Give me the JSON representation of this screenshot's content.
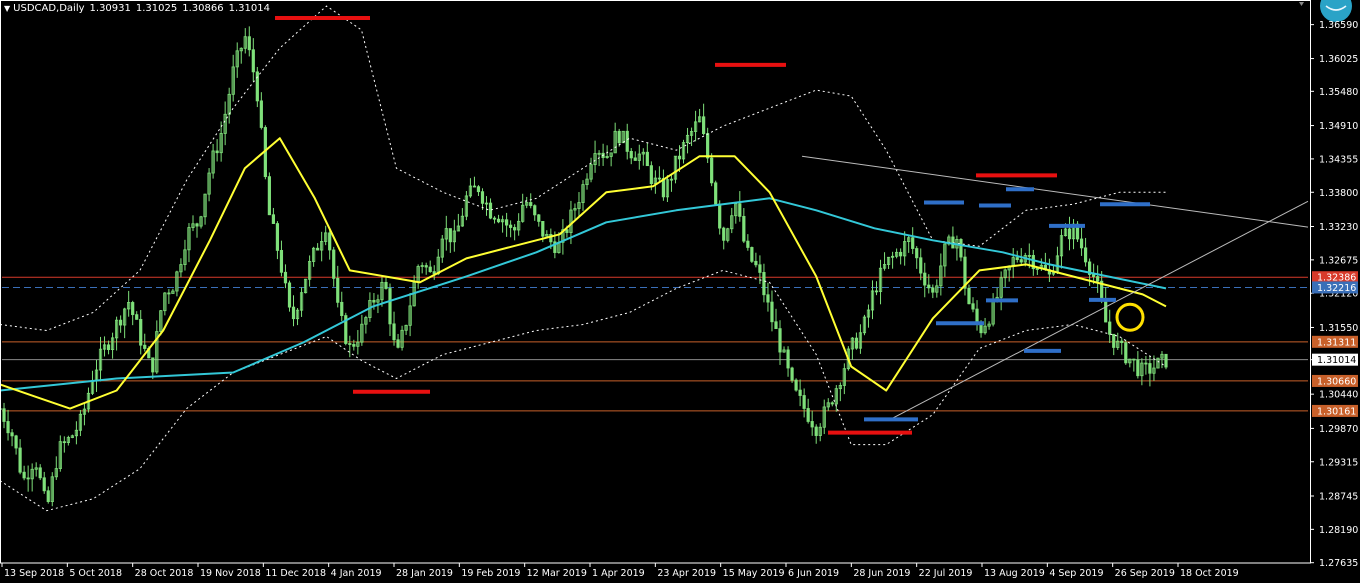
{
  "header": {
    "symbol": "USDCAD,Daily",
    "open": "1.30931",
    "high": "1.31025",
    "low": "1.30866",
    "close": "1.31014"
  },
  "colors": {
    "background": "#000000",
    "grid_frame": "#ffffff",
    "candle": "#7fe07a",
    "ma_fast": "#ffff33",
    "ma_slow": "#33c8d8",
    "bollinger": "#ffffff",
    "support_resistance": "#e04030",
    "marker_red": "#e81010",
    "marker_blue": "#2f6fc8",
    "circle": "#ffe000",
    "price_tag_orange": "#c8602a",
    "price_tag_red": "#d83a2a",
    "price_tag_blue": "#3a6fb8",
    "price_tag_current": "#ffffff"
  },
  "chart_data": {
    "type": "line",
    "ylim": [
      1.2763,
      1.368
    ],
    "y_ticks": [
      "1.36590",
      "1.36025",
      "1.35480",
      "1.34910",
      "1.34355",
      "1.33800",
      "1.33230",
      "1.32675",
      "1.32120",
      "1.31550",
      "1.31014",
      "1.30440",
      "1.29870",
      "1.29315",
      "1.28745",
      "1.28190",
      "1.27635"
    ],
    "x_tick_labels": [
      "13 Sep 2018",
      "5 Oct 2018",
      "28 Oct 2018",
      "19 Nov 2018",
      "11 Dec 2018",
      "4 Jan 2019",
      "28 Jan 2019",
      "19 Feb 2019",
      "12 Mar 2019",
      "1 Apr 2019",
      "23 Apr 2019",
      "15 May 2019",
      "6 Jun 2019",
      "28 Jun 2019",
      "22 Jul 2019",
      "13 Aug 2019",
      "4 Sep 2019",
      "26 Sep 2019",
      "18 Oct 2019"
    ],
    "series": [
      {
        "key": "price",
        "t": [
          0,
          0.01,
          0.02,
          0.03,
          0.04,
          0.05,
          0.06,
          0.07,
          0.08,
          0.09,
          0.1,
          0.11,
          0.12,
          0.13,
          0.14,
          0.15,
          0.16,
          0.17,
          0.18,
          0.19,
          0.2,
          0.21,
          0.22,
          0.23,
          0.24,
          0.25,
          0.26,
          0.27,
          0.28,
          0.29,
          0.3,
          0.31,
          0.32,
          0.33,
          0.34,
          0.35,
          0.36,
          0.37,
          0.38,
          0.39,
          0.4,
          0.41,
          0.42,
          0.43,
          0.44,
          0.45,
          0.46,
          0.47,
          0.48,
          0.49,
          0.5,
          0.51,
          0.52,
          0.53,
          0.54,
          0.55,
          0.56,
          0.57,
          0.58,
          0.59,
          0.6,
          0.61,
          0.62,
          0.63,
          0.64,
          0.65,
          0.66,
          0.67,
          0.68,
          0.69,
          0.7,
          0.71,
          0.72,
          0.73,
          0.74,
          0.75,
          0.76,
          0.77,
          0.78,
          0.79,
          0.8,
          0.81,
          0.82,
          0.83,
          0.84,
          0.85,
          0.86,
          0.87,
          0.88,
          0.89,
          0.9,
          0.91,
          0.92,
          0.93,
          0.94,
          0.95,
          0.96,
          0.97,
          0.98,
          0.99,
          1.0
        ],
        "y": [
          1.302,
          1.298,
          1.29,
          1.294,
          1.285,
          1.295,
          1.297,
          1.3,
          1.308,
          1.312,
          1.316,
          1.32,
          1.314,
          1.308,
          1.321,
          1.323,
          1.331,
          1.333,
          1.342,
          1.348,
          1.358,
          1.364,
          1.356,
          1.335,
          1.327,
          1.316,
          1.323,
          1.328,
          1.333,
          1.318,
          1.312,
          1.315,
          1.32,
          1.323,
          1.31,
          1.318,
          1.327,
          1.324,
          1.332,
          1.33,
          1.337,
          1.339,
          1.335,
          1.334,
          1.331,
          1.337,
          1.333,
          1.33,
          1.329,
          1.334,
          1.339,
          1.346,
          1.344,
          1.348,
          1.345,
          1.344,
          1.34,
          1.338,
          1.343,
          1.347,
          1.35,
          1.341,
          1.33,
          1.337,
          1.328,
          1.325,
          1.318,
          1.312,
          1.305,
          1.302,
          1.299,
          1.302,
          1.307,
          1.312,
          1.315,
          1.322,
          1.326,
          1.328,
          1.33,
          1.325,
          1.321,
          1.328,
          1.331,
          1.32,
          1.315,
          1.318,
          1.323,
          1.327,
          1.328,
          1.326,
          1.324,
          1.33,
          1.332,
          1.328,
          1.323,
          1.315,
          1.312,
          1.31,
          1.308,
          1.309,
          1.3101
        ]
      },
      {
        "key": "ma_fast",
        "t": [
          0,
          0.03,
          0.06,
          0.1,
          0.14,
          0.18,
          0.21,
          0.24,
          0.27,
          0.3,
          0.33,
          0.36,
          0.4,
          0.44,
          0.48,
          0.52,
          0.56,
          0.6,
          0.63,
          0.66,
          0.7,
          0.73,
          0.76,
          0.8,
          0.84,
          0.88,
          0.92,
          0.96,
          0.98,
          1.0
        ],
        "y": [
          1.306,
          1.304,
          1.302,
          1.305,
          1.315,
          1.33,
          1.342,
          1.347,
          1.337,
          1.325,
          1.324,
          1.323,
          1.327,
          1.329,
          1.331,
          1.338,
          1.339,
          1.344,
          1.344,
          1.338,
          1.324,
          1.309,
          1.305,
          1.317,
          1.325,
          1.326,
          1.324,
          1.322,
          1.321,
          1.319
        ]
      },
      {
        "key": "ma_slow",
        "t": [
          0,
          0.1,
          0.2,
          0.26,
          0.32,
          0.4,
          0.46,
          0.52,
          0.58,
          0.62,
          0.66,
          0.7,
          0.75,
          0.8,
          0.86,
          0.9,
          0.95,
          1.0
        ],
        "y": [
          1.305,
          1.307,
          1.308,
          1.313,
          1.319,
          1.324,
          1.328,
          1.333,
          1.335,
          1.336,
          1.337,
          1.335,
          1.332,
          1.33,
          1.328,
          1.326,
          1.324,
          1.322
        ]
      },
      {
        "key": "boll_upper",
        "t": [
          0,
          0.04,
          0.08,
          0.12,
          0.16,
          0.2,
          0.24,
          0.28,
          0.31,
          0.34,
          0.38,
          0.42,
          0.46,
          0.5,
          0.54,
          0.58,
          0.62,
          0.66,
          0.7,
          0.73,
          0.76,
          0.8,
          0.84,
          0.88,
          0.92,
          0.96,
          1.0
        ],
        "y": [
          1.316,
          1.315,
          1.318,
          1.325,
          1.34,
          1.352,
          1.362,
          1.369,
          1.365,
          1.342,
          1.338,
          1.335,
          1.337,
          1.342,
          1.347,
          1.345,
          1.349,
          1.352,
          1.355,
          1.354,
          1.345,
          1.33,
          1.329,
          1.335,
          1.336,
          1.338,
          1.338
        ]
      },
      {
        "key": "boll_lower",
        "t": [
          0,
          0.04,
          0.08,
          0.12,
          0.16,
          0.2,
          0.24,
          0.28,
          0.31,
          0.34,
          0.38,
          0.42,
          0.46,
          0.5,
          0.54,
          0.58,
          0.62,
          0.66,
          0.7,
          0.73,
          0.76,
          0.8,
          0.84,
          0.88,
          0.92,
          0.96,
          1.0
        ],
        "y": [
          1.29,
          1.285,
          1.287,
          1.292,
          1.302,
          1.308,
          1.311,
          1.314,
          1.31,
          1.307,
          1.311,
          1.313,
          1.315,
          1.316,
          1.318,
          1.322,
          1.325,
          1.323,
          1.311,
          1.296,
          1.296,
          1.301,
          1.312,
          1.315,
          1.316,
          1.314,
          1.309
        ]
      }
    ],
    "price_tags": [
      {
        "text": "1.32386",
        "value": 1.32386,
        "style": "red"
      },
      {
        "text": "1.32216",
        "value": 1.32216,
        "style": "blue"
      },
      {
        "text": "1.31311",
        "value": 1.31311,
        "style": "orange"
      },
      {
        "text": "1.31014",
        "value": 1.31014,
        "style": "current"
      },
      {
        "text": "1.30660",
        "value": 1.3066,
        "style": "orange"
      },
      {
        "text": "1.30161",
        "value": 1.30161,
        "style": "orange"
      }
    ]
  }
}
